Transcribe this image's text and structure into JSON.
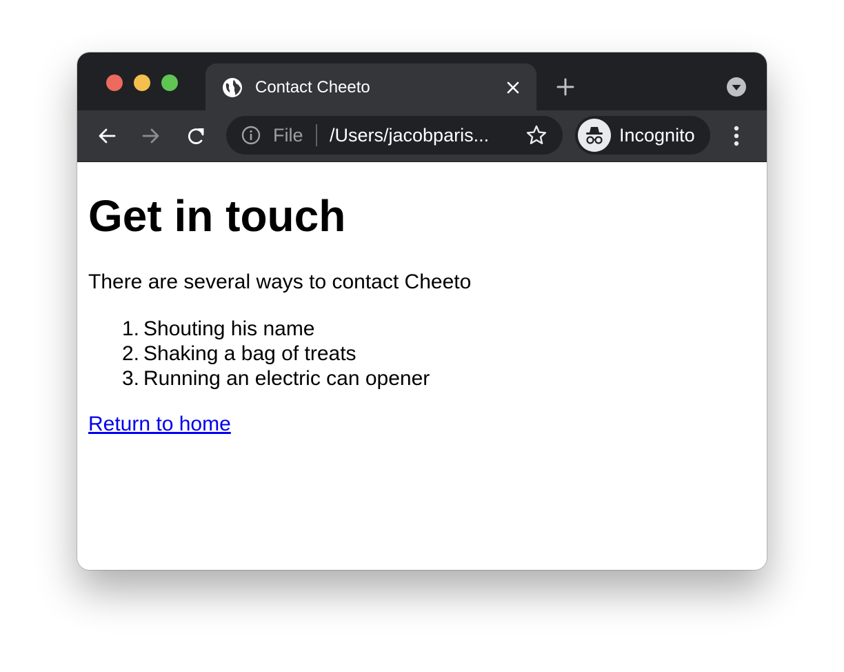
{
  "browser": {
    "tab": {
      "title": "Contact Cheeto",
      "favicon": "globe-icon"
    },
    "address_bar": {
      "scheme_label": "File",
      "url": "/Users/jacobparis..."
    },
    "profile": {
      "label": "Incognito",
      "icon": "incognito-icon"
    },
    "colors": {
      "tabbar_bg": "#202124",
      "toolbar_bg": "#35363a",
      "close": "#ed6a5e",
      "minimize": "#f5bf4f",
      "maximize": "#61c554",
      "link": "#0000ee"
    }
  },
  "page": {
    "title": "Get in touch",
    "intro": "There are several ways to contact Cheeto",
    "ways": [
      {
        "number": "1.",
        "text": "Shouting his name"
      },
      {
        "number": "2.",
        "text": "Shaking a bag of treats"
      },
      {
        "number": "3.",
        "text": "Running an electric can opener"
      }
    ],
    "return_link": "Return to home"
  }
}
